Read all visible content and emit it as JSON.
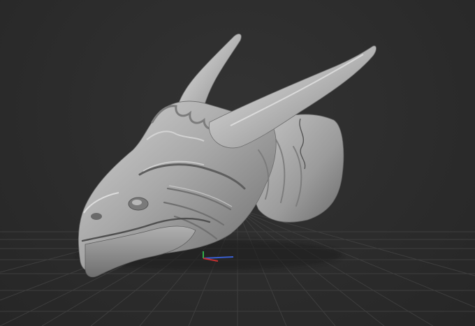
{
  "viewport": {
    "background_color": "#2e2e2e",
    "grid_color": "#3d3d3d",
    "grid_on": true,
    "model": {
      "subject": "dragon-head-sculpt",
      "material_color": "#9a9a9a"
    },
    "gizmo": {
      "x_axis_color": "#3a5fd0",
      "y_axis_color": "#32b04a",
      "z_axis_color": "#c43030"
    }
  }
}
